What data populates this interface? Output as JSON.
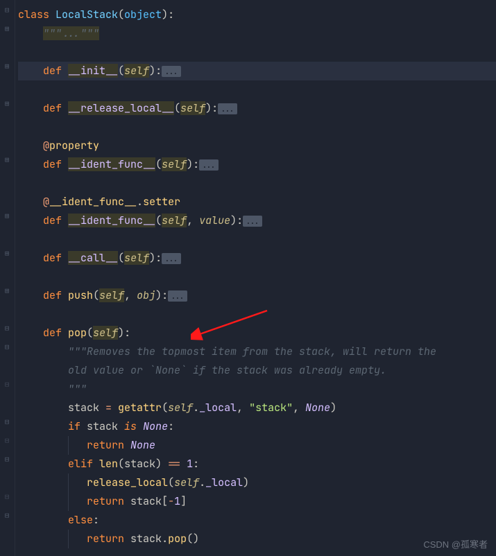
{
  "code": {
    "l1": {
      "kw_class": "class ",
      "name": "LocalStack",
      "p1": "(",
      "base": "object",
      "p2": "):"
    },
    "l2": {
      "doc_open": "\"\"\"",
      "dots": "...",
      "doc_close": "\"\"\""
    },
    "l4": {
      "kw_def": "def ",
      "name": "__init__",
      "p1": "(",
      "self": "self",
      "p2": "):",
      "dots": "..."
    },
    "l6": {
      "kw_def": "def ",
      "name": "__release_local__",
      "p1": "(",
      "self": "self",
      "p2": "):",
      "dots": "..."
    },
    "l8": {
      "at": "@",
      "dec": "property"
    },
    "l9": {
      "kw_def": "def ",
      "name": "__ident_func__",
      "p1": "(",
      "self": "self",
      "p2": "):",
      "dots": "..."
    },
    "l11": {
      "at": "@",
      "dec": "__ident_func__",
      "dot": ".",
      "setter": "setter"
    },
    "l12": {
      "kw_def": "def ",
      "name": "__ident_func__",
      "p1": "(",
      "self": "self",
      "c": ", ",
      "val": "value",
      "p2": "):",
      "dots": "..."
    },
    "l14": {
      "kw_def": "def ",
      "name": "__call__",
      "p1": "(",
      "self": "self",
      "p2": "):",
      "dots": "..."
    },
    "l16": {
      "kw_def": "def ",
      "name": "push",
      "p1": "(",
      "self": "self",
      "c": ", ",
      "obj": "obj",
      "p2": "):",
      "dots": "..."
    },
    "l18": {
      "kw_def": "def ",
      "name": "pop",
      "p1": "(",
      "self": "self",
      "p2": "):"
    },
    "l19": {
      "doc": "\"\"\"Removes the topmost item from the stack, will return the"
    },
    "l20": {
      "doc": "old value or `None` if the stack was already empty."
    },
    "l21": {
      "doc": "\"\"\""
    },
    "l22": {
      "lhs": "stack ",
      "eq": "= ",
      "fn": "getattr",
      "p1": "(",
      "self": "self",
      "dot": ".",
      "attr": "_local",
      "c": ", ",
      "str": "\"stack\"",
      "c2": ", ",
      "none": "None",
      "p2": ")"
    },
    "l23": {
      "kw": "if ",
      "ident": "stack ",
      "is": "is ",
      "none": "None",
      "colon": ":"
    },
    "l24": {
      "kw": "return ",
      "none": "None"
    },
    "l25": {
      "kw": "elif ",
      "fn": "len",
      "p1": "(",
      "ident": "stack",
      "p2": ") ",
      "eq": "== ",
      "one": "1",
      "colon": ":"
    },
    "l26": {
      "fn": "release_local",
      "p1": "(",
      "self": "self",
      "dot": ".",
      "attr": "_local",
      "p2": ")"
    },
    "l27": {
      "kw": "return ",
      "ident": "stack",
      "br1": "[",
      "neg": "-",
      "one": "1",
      "br2": "]"
    },
    "l28": {
      "kw": "else",
      "colon": ":"
    },
    "l29": {
      "kw": "return ",
      "ident": "stack",
      "dot": ".",
      "fn": "pop",
      "p": "()"
    }
  },
  "watermark": "CSDN @孤寒者"
}
